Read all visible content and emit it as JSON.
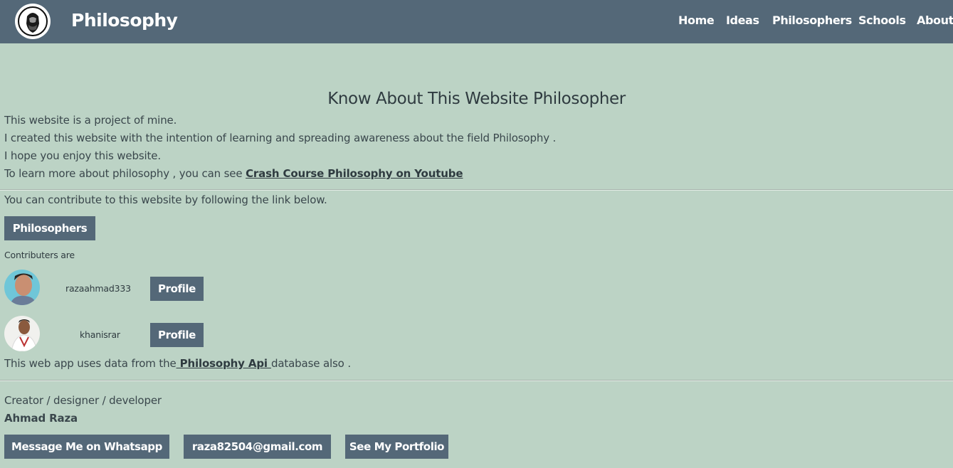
{
  "header": {
    "brand": "Philosophy",
    "nav": [
      "Home",
      "Ideas",
      "Philosophers",
      "Schools",
      "About"
    ]
  },
  "main": {
    "title": "Know About This Website Philosopher",
    "intro": [
      "This website is a project of mine.",
      "I created this website with the intention of learning and spreading awareness about the field Philosophy .",
      "I hope you enjoy this website."
    ],
    "learn_prefix": "To learn more about philosophy , you can see ",
    "learn_link": "Crash Course Philosophy on Youtube",
    "contribute_text": "You can contribute to this website by following the link below.",
    "philosophers_button": "Philosophers",
    "contributors_label": "Contributers are",
    "contributors": [
      {
        "name": "razaahmad333",
        "button": "Profile"
      },
      {
        "name": "khanisrar",
        "button": "Profile"
      }
    ],
    "api_prefix": "This web app uses data from the",
    "api_link": " Philosophy Api ",
    "api_suffix": "database also ."
  },
  "creator": {
    "role": "Creator / designer / developer",
    "name": "Ahmad Raza",
    "buttons": [
      "Message Me on Whatsapp",
      "raza82504@gmail.com",
      "See My Portfolio"
    ]
  },
  "colors": {
    "background": "#bcd3c5",
    "header": "#546878",
    "button": "#546878",
    "text": "#2f3b40"
  }
}
